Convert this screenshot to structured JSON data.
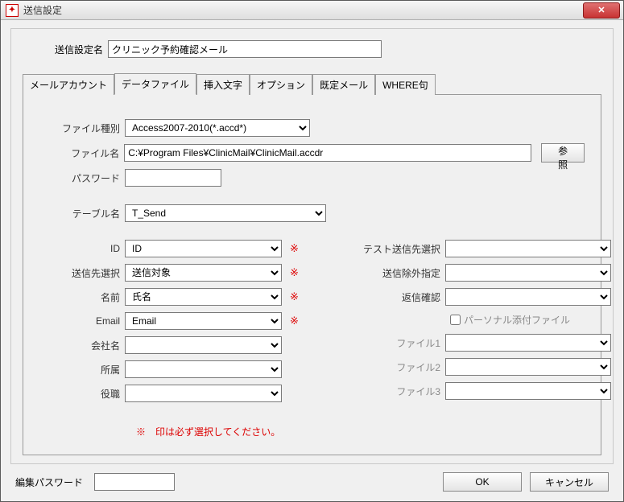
{
  "window": {
    "title": "送信設定"
  },
  "setting_name": {
    "label": "送信設定名",
    "value": "クリニック予約確認メール"
  },
  "tabs": {
    "mail_account": "メールアカウント",
    "data_file": "データファイル",
    "insert_text": "挿入文字",
    "option": "オプション",
    "default_mail": "既定メール",
    "where": "WHERE句"
  },
  "fields": {
    "file_type": {
      "label": "ファイル種別",
      "value": "Access2007-2010(*.accd*)"
    },
    "file_name": {
      "label": "ファイル名",
      "value": "C:¥Program Files¥ClinicMail¥ClinicMail.accdr"
    },
    "browse": "参照",
    "password": {
      "label": "パスワード",
      "value": ""
    },
    "table_name": {
      "label": "テーブル名",
      "value": "T_Send"
    },
    "id": {
      "label": "ID",
      "value": "ID"
    },
    "dest_select": {
      "label": "送信先選択",
      "value": "送信対象"
    },
    "name": {
      "label": "名前",
      "value": "氏名"
    },
    "email": {
      "label": "Email",
      "value": "Email"
    },
    "company": {
      "label": "会社名",
      "value": ""
    },
    "department": {
      "label": "所属",
      "value": ""
    },
    "position": {
      "label": "役職",
      "value": ""
    },
    "test_dest": {
      "label": "テスト送信先選択",
      "value": ""
    },
    "exclude": {
      "label": "送信除外指定",
      "value": ""
    },
    "reply_confirm": {
      "label": "返信確認",
      "value": ""
    },
    "personal_attach": {
      "label": "パーソナル添付ファイル"
    },
    "file1": {
      "label": "ファイル1",
      "value": ""
    },
    "file2": {
      "label": "ファイル2",
      "value": ""
    },
    "file3": {
      "label": "ファイル3",
      "value": ""
    }
  },
  "req_mark": "※",
  "req_note": "※　印は必ず選択してください。",
  "edit_password": {
    "label": "編集パスワード",
    "value": ""
  },
  "buttons": {
    "ok": "OK",
    "cancel": "キャンセル"
  }
}
